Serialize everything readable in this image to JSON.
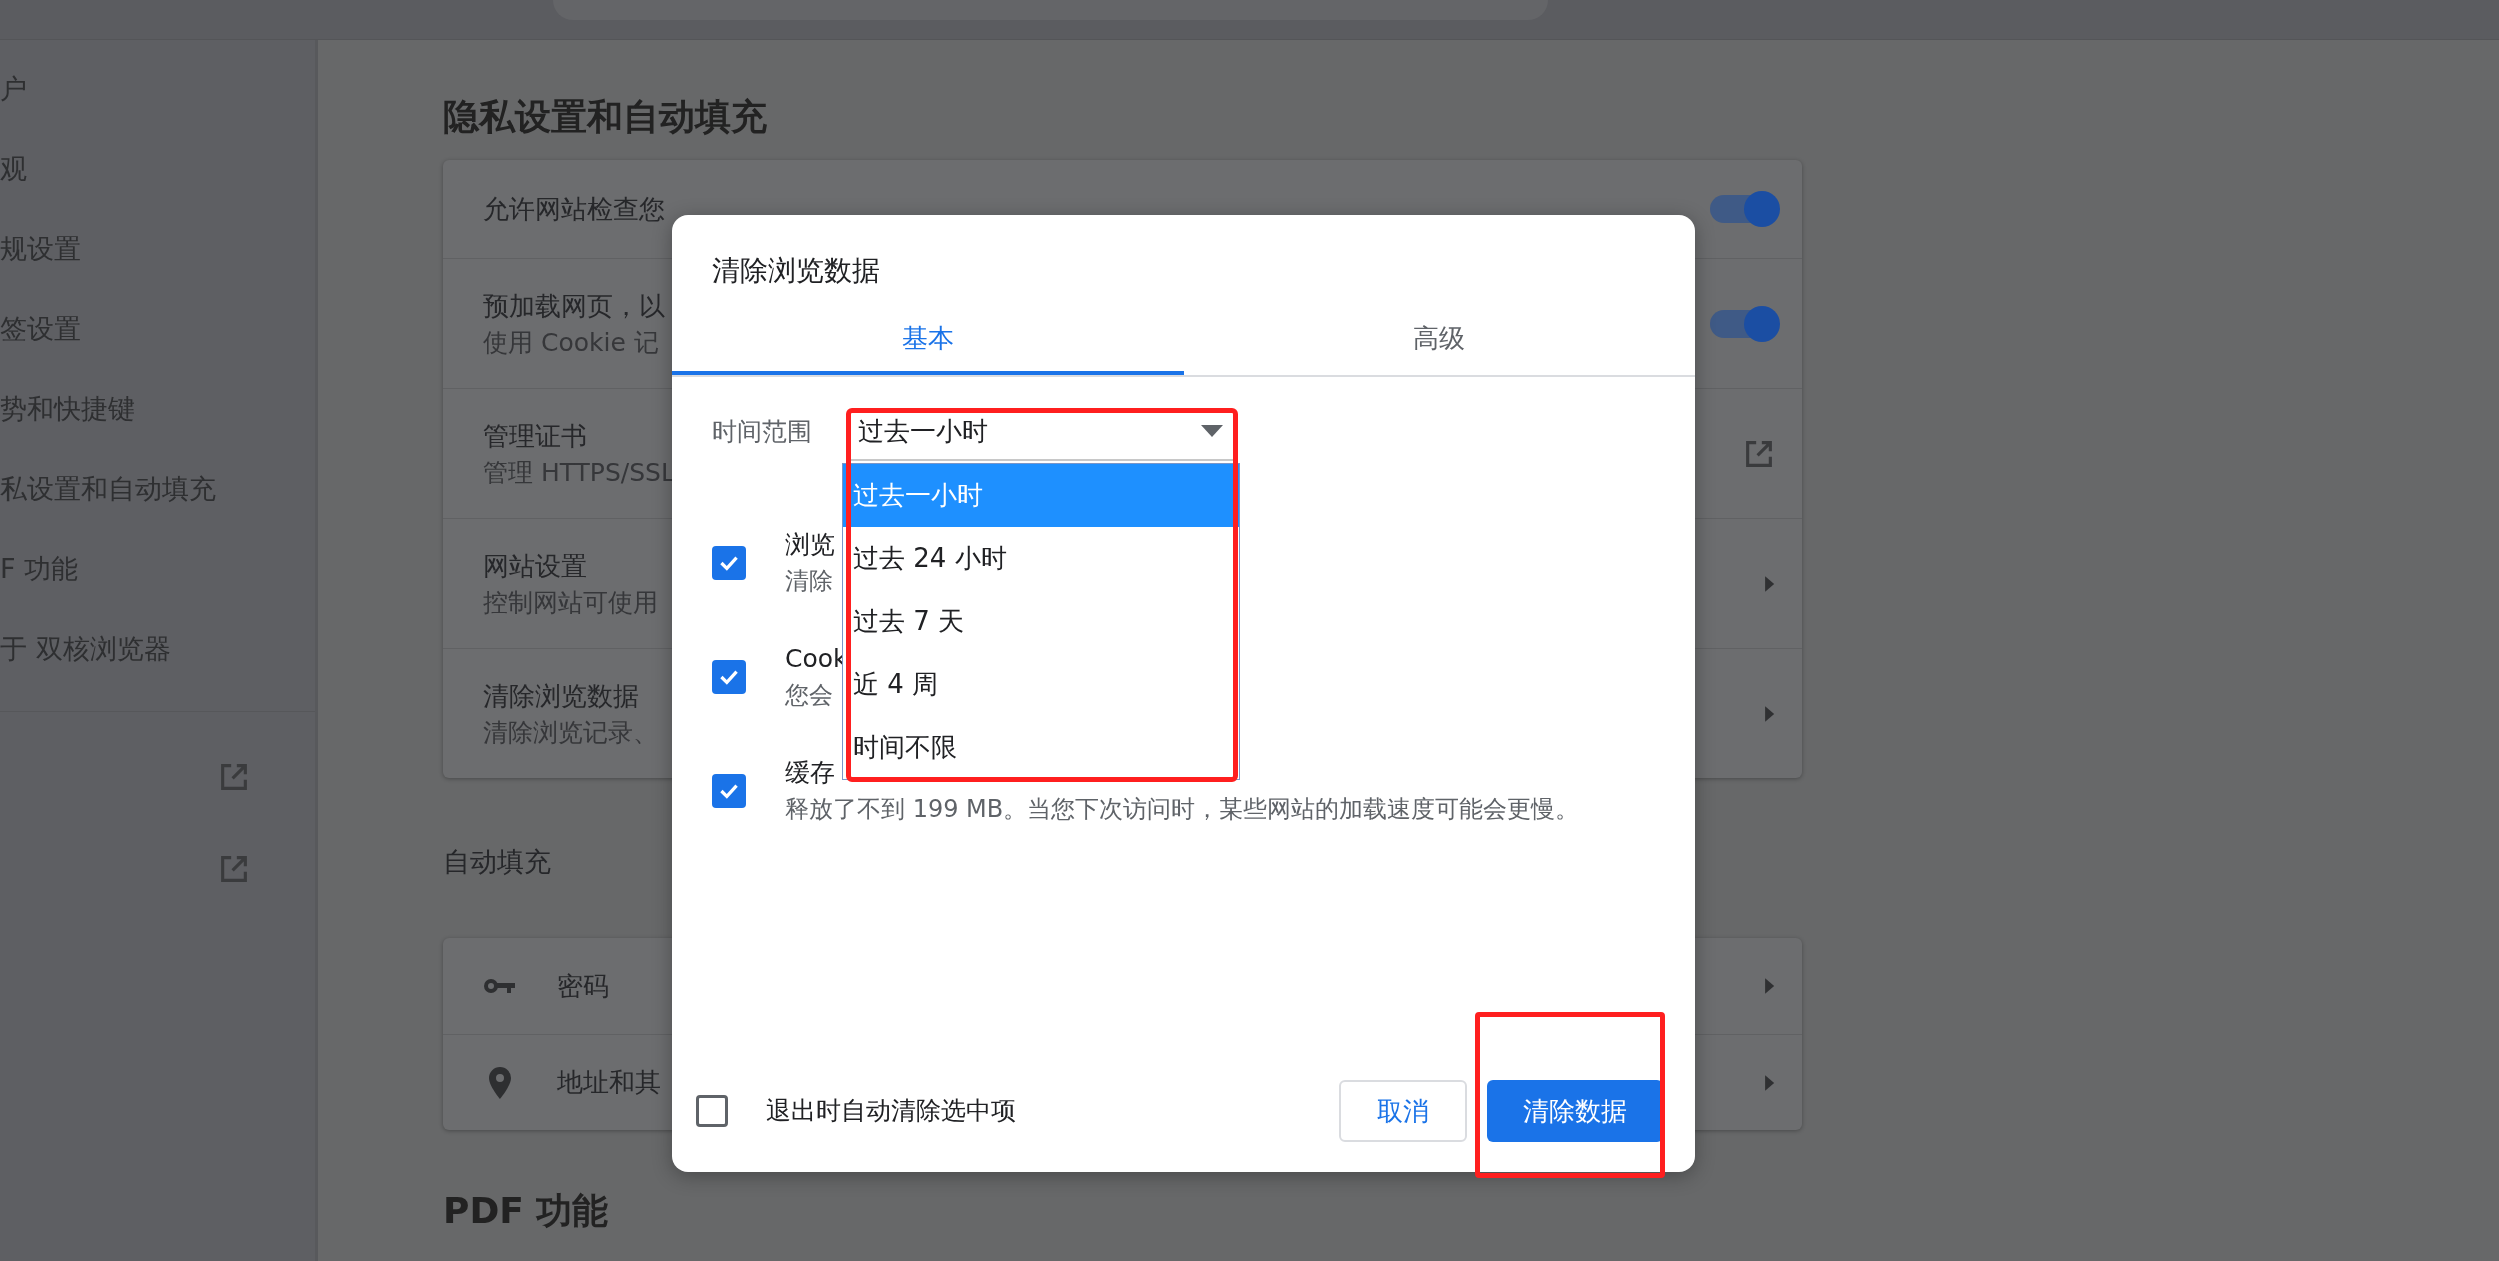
{
  "sidebar": {
    "items": [
      {
        "label": "户"
      },
      {
        "label": "观"
      },
      {
        "label": "规设置"
      },
      {
        "label": "签设置"
      },
      {
        "label": "势和快捷键"
      },
      {
        "label": "私设置和自动填充"
      },
      {
        "label": "F 功能"
      },
      {
        "label": "于 双核浏览器"
      }
    ]
  },
  "privacy": {
    "heading": "隐私设置和自动填充",
    "rows": [
      {
        "kind": "toggle",
        "title": "允许网站检查您",
        "on": true
      },
      {
        "kind": "toggle",
        "title": "预加载网页，以",
        "subtitle": "使用 Cookie 记",
        "on": true
      },
      {
        "kind": "external",
        "title": "管理证书",
        "subtitle": "管理 HTTPS/SSL"
      },
      {
        "kind": "arrow",
        "title": "网站设置",
        "subtitle": "控制网站可使用"
      },
      {
        "kind": "arrow",
        "title": "清除浏览数据",
        "subtitle": "清除浏览记录、"
      }
    ]
  },
  "autofill": {
    "heading": "自动填充",
    "rows": [
      {
        "kind": "key",
        "label": "密码"
      },
      {
        "kind": "pin",
        "label": "地址和其"
      }
    ]
  },
  "pdf": {
    "heading": "PDF 功能"
  },
  "dialog": {
    "title": "清除浏览数据",
    "tabs": [
      {
        "label": "基本",
        "selected": true
      },
      {
        "label": "高级",
        "selected": false
      }
    ],
    "time_range": {
      "label": "时间范围",
      "value": "过去一小时",
      "expanded": true,
      "options": [
        {
          "label": "过去一小时",
          "selected": true
        },
        {
          "label": "过去 24 小时",
          "selected": false
        },
        {
          "label": "过去 7 天",
          "selected": false
        },
        {
          "label": "近 4 周",
          "selected": false
        },
        {
          "label": "时间不限",
          "selected": false
        }
      ]
    },
    "items": [
      {
        "title": "浏览",
        "description": "清除",
        "checked": true
      },
      {
        "title": "Cook",
        "description": "您会",
        "checked": true
      },
      {
        "title": "缓存",
        "description": "释放了不到 199 MB。当您下次访问时，某些网站的加载速度可能会更慢。",
        "checked": true
      }
    ],
    "auto_clear": {
      "label": "退出时自动清除选中项",
      "checked": false
    },
    "buttons": [
      {
        "label": "取消",
        "kind": "secondary"
      },
      {
        "label": "清除数据",
        "kind": "primary"
      }
    ]
  }
}
